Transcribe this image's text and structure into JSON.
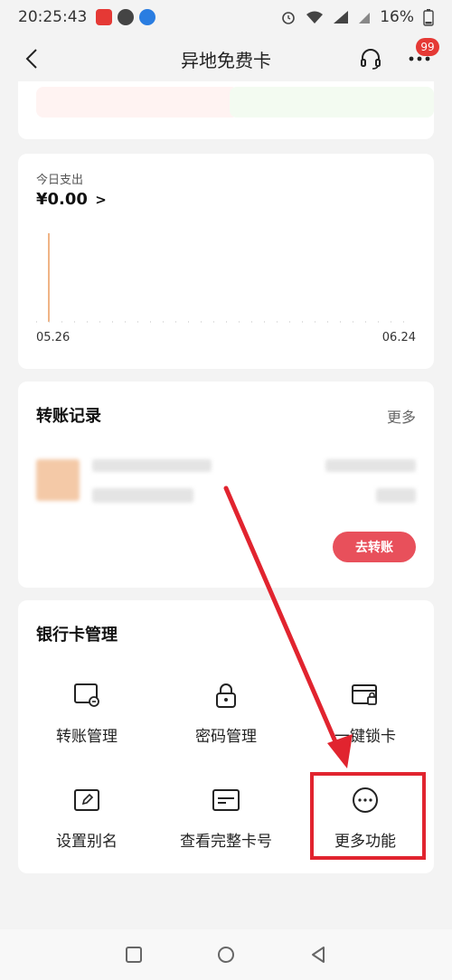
{
  "status": {
    "time": "20:25:43",
    "battery": "16%"
  },
  "header": {
    "title": "异地免费卡",
    "badge": "99"
  },
  "spend": {
    "label": "今日支出",
    "amount": "¥0.00",
    "chevron": ">",
    "date_start": "05.26",
    "date_end": "06.24"
  },
  "transfer": {
    "title": "转账记录",
    "more": "更多",
    "button": "去转账"
  },
  "bank": {
    "title": "银行卡管理",
    "items": [
      {
        "label": "转账管理",
        "icon": "transfer-manage-icon"
      },
      {
        "label": "密码管理",
        "icon": "lock-icon"
      },
      {
        "label": "一键锁卡",
        "icon": "card-lock-icon"
      },
      {
        "label": "设置别名",
        "icon": "edit-icon"
      },
      {
        "label": "查看完整卡号",
        "icon": "card-number-icon"
      },
      {
        "label": "更多功能",
        "icon": "more-circle-icon"
      }
    ]
  },
  "colors": {
    "accent": "#e8505b",
    "annotation": "#e1242f"
  }
}
